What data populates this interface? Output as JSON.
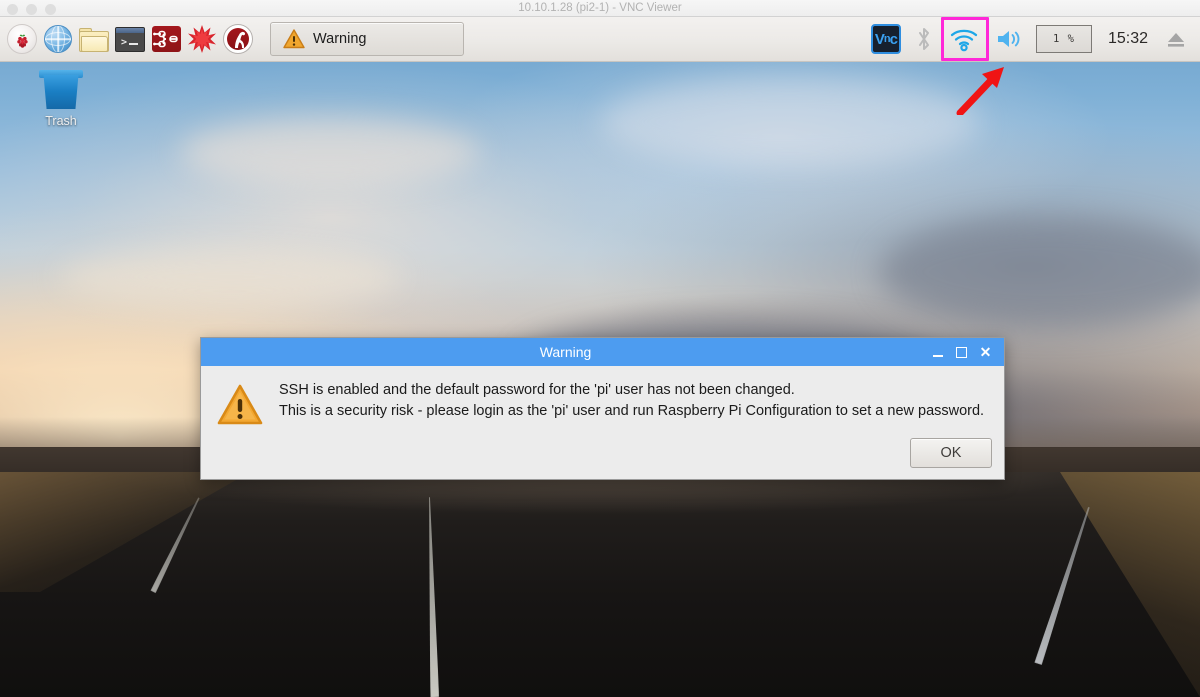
{
  "host_window": {
    "title": "10.10.1.28 (pi2-1) - VNC Viewer",
    "traffic_lights": [
      "close",
      "minimize",
      "zoom"
    ]
  },
  "desktop": {
    "icons": [
      {
        "name": "trash",
        "label": "Trash"
      }
    ],
    "wallpaper_description": "Sunset sky over an empty asphalt road"
  },
  "taskbar": {
    "launchers": [
      {
        "name": "raspberry-menu",
        "label": "Menu",
        "icon": "raspberry-icon"
      },
      {
        "name": "web-browser",
        "label": "Web Browser",
        "icon": "globe-icon"
      },
      {
        "name": "file-manager",
        "label": "File Manager",
        "icon": "folder-icon"
      },
      {
        "name": "terminal",
        "label": "Terminal",
        "icon": "terminal-icon"
      },
      {
        "name": "node-red",
        "label": "Node-RED",
        "icon": "node-red-icon"
      },
      {
        "name": "mathematica",
        "label": "Mathematica",
        "icon": "mathematica-icon"
      },
      {
        "name": "wolfram",
        "label": "Wolfram",
        "icon": "wolfram-icon"
      }
    ],
    "task_button": {
      "label": "Warning",
      "icon": "warning-triangle-icon",
      "active": true
    },
    "tray": {
      "vnc": {
        "label": "VNC",
        "icon": "vnc-icon"
      },
      "bluetooth": {
        "label": "Bluetooth",
        "icon": "bluetooth-icon",
        "enabled": false
      },
      "wifi": {
        "label": "Wireless Network",
        "icon": "wifi-icon",
        "highlighted": true
      },
      "volume": {
        "label": "Volume",
        "icon": "speaker-icon"
      },
      "cpu": {
        "label": "CPU",
        "value": "1 %"
      },
      "clock": {
        "value": "15:32"
      },
      "eject": {
        "label": "Eject",
        "icon": "eject-icon"
      }
    }
  },
  "annotation": {
    "highlight_color": "#ff28d8",
    "arrow_color": "#f01414",
    "points_to": "wifi-icon"
  },
  "dialog": {
    "title": "Warning",
    "icon": "warning-triangle-icon",
    "line1": "SSH is enabled and the default password for the 'pi' user has not been changed.",
    "line2": "This is a security risk - please login as the 'pi' user and run Raspberry Pi Configuration to set a new password.",
    "ok_label": "OK",
    "titlebar_color": "#4d9cf0",
    "buttons": {
      "minimize": "minimize",
      "maximize": "maximize",
      "close": "close"
    }
  }
}
